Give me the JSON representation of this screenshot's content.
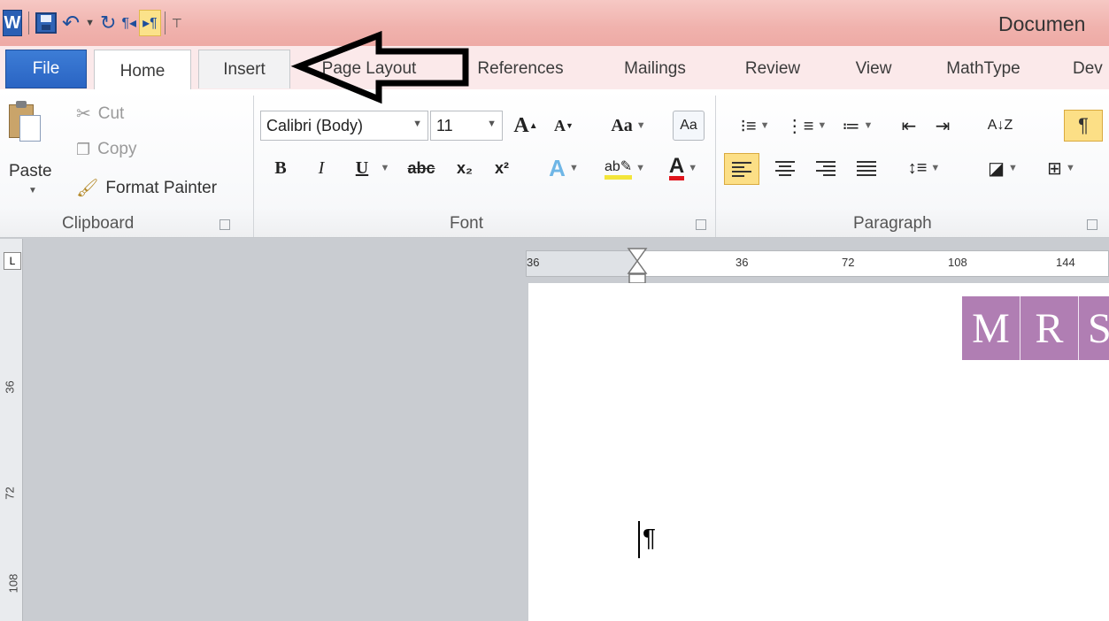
{
  "window": {
    "title": "Documen"
  },
  "qat": {
    "icons": [
      "word-icon",
      "save-icon",
      "undo-icon",
      "dropdown-icon",
      "redo-icon",
      "paragraph-rtl-icon",
      "paragraph-ltr-icon",
      "customize-icon"
    ]
  },
  "tabs": [
    "File",
    "Home",
    "Insert",
    "Page Layout",
    "References",
    "Mailings",
    "Review",
    "View",
    "MathType",
    "Dev"
  ],
  "clipboard": {
    "paste": "Paste",
    "cut": "Cut",
    "copy": "Copy",
    "format_painter": "Format Painter",
    "label": "Clipboard"
  },
  "font": {
    "family": "Calibri (Body)",
    "size": "11",
    "change_case": "Aa",
    "bold": "B",
    "italic": "I",
    "underline": "U",
    "strike": "abc",
    "subscript": "x₂",
    "superscript": "x²",
    "label": "Font"
  },
  "paragraph": {
    "label": "Paragraph",
    "show_marks": "¶",
    "sort": "A↓Z"
  },
  "ruler": {
    "h_labels": [
      "36",
      "36",
      "72",
      "108",
      "144"
    ],
    "v_labels": [
      "36",
      "72",
      "108"
    ]
  },
  "document": {
    "logo_letters": [
      "M",
      "R",
      "S"
    ],
    "pilcrow": "¶"
  },
  "colors": {
    "accent": "#2a64c3",
    "highlight": "#fcdf86",
    "logo": "#b07eb3",
    "title_bar": "#f0b2ad"
  }
}
